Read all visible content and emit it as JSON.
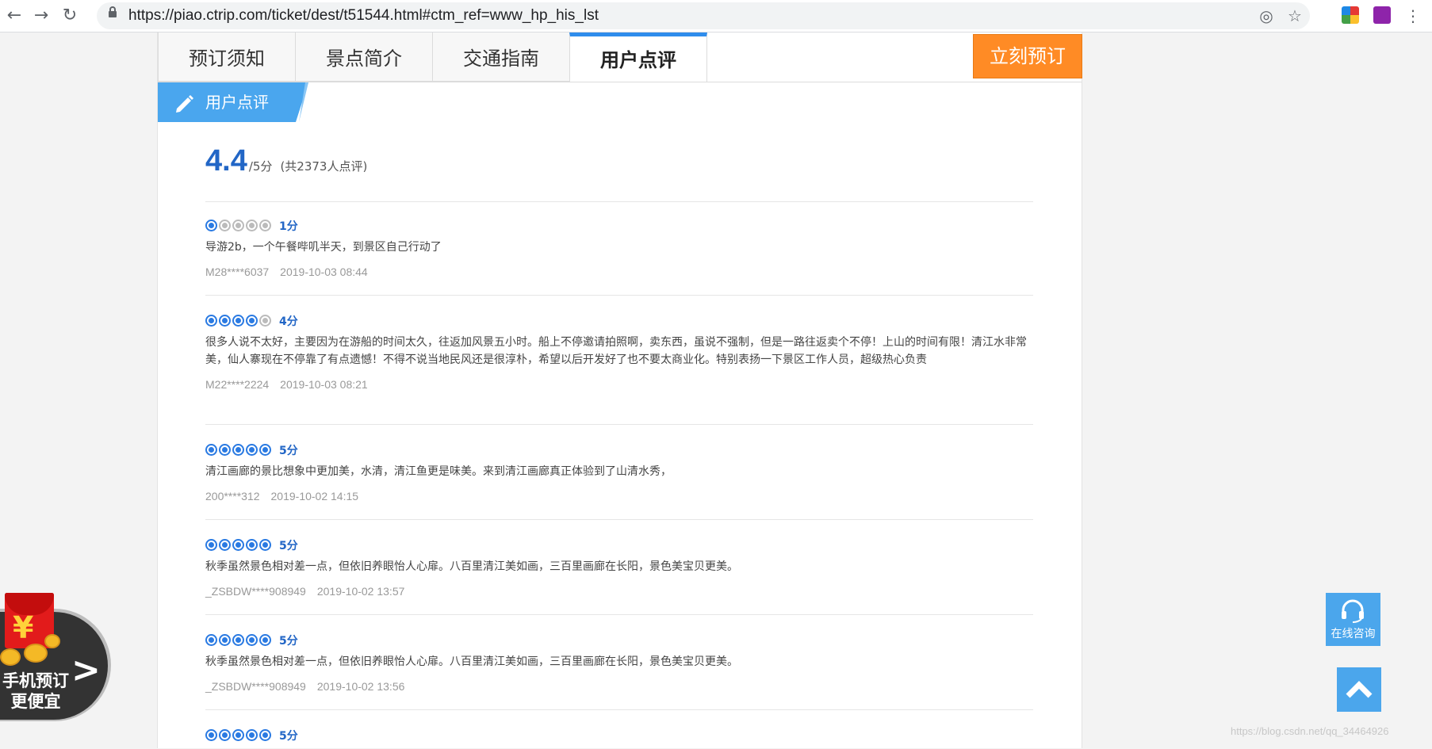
{
  "browser": {
    "url": "https://piao.ctrip.com/ticket/dest/t51544.html#ctm_ref=www_hp_his_lst",
    "icons": [
      "back-icon",
      "forward-icon",
      "reload-icon",
      "lock-icon",
      "location-icon",
      "star-icon",
      "extension-icon",
      "kebab-menu-icon"
    ]
  },
  "tabs": [
    {
      "label": "预订须知"
    },
    {
      "label": "景点简介"
    },
    {
      "label": "交通指南"
    },
    {
      "label": "用户点评",
      "active": true
    }
  ],
  "book_button": "立刻预订",
  "section_title": "用户点评",
  "summary": {
    "score": "4.4",
    "max": "/5分",
    "count": "(共2373人点评)"
  },
  "reviews": [
    {
      "rating": 1,
      "score_label": "1分",
      "text": "导游2b，一个午餐哔叽半天，到景区自己行动了",
      "user": "M28****6037",
      "time": "2019-10-03 08:44"
    },
    {
      "rating": 4,
      "score_label": "4分",
      "text": "很多人说不太好，主要因为在游船的时间太久，往返加风景五小时。船上不停邀请拍照啊，卖东西，虽说不强制，但是一路往返卖个不停！上山的时间有限！清江水非常美，仙人寨现在不停靠了有点遗憾！不得不说当地民风还是很淳朴，希望以后开发好了也不要太商业化。特别表扬一下景区工作人员，超级热心负责",
      "user": "M22****2224",
      "time": "2019-10-03 08:21"
    },
    {
      "rating": 5,
      "score_label": "5分",
      "text": "清江画廊的景比想象中更加美，水清，清江鱼更是味美。来到清江画廊真正体验到了山清水秀，",
      "user": "200****312",
      "time": "2019-10-02 14:15"
    },
    {
      "rating": 5,
      "score_label": "5分",
      "text": "秋季虽然景色相对差一点，但依旧养眼怡人心扉。八百里清江美如画，三百里画廊在长阳，景色美宝贝更美。",
      "user": "_ZSBDW****908949",
      "time": "2019-10-02 13:57"
    },
    {
      "rating": 5,
      "score_label": "5分",
      "text": "秋季虽然景色相对差一点，但依旧养眼怡人心扉。八百里清江美如画，三百里画廊在长阳，景色美宝贝更美。",
      "user": "_ZSBDW****908949",
      "time": "2019-10-02 13:56"
    },
    {
      "rating": 5,
      "score_label": "5分",
      "text": "",
      "user": "",
      "time": ""
    }
  ],
  "promo": {
    "line1": "手机预订",
    "line2": "更便宜",
    "symbol": "¥"
  },
  "consult_label": "在线咨询",
  "watermark": "https://blog.csdn.net/qq_34464926",
  "colors": {
    "accent": "#2f8dec",
    "score_blue": "#2266c6",
    "book_orange": "#ff8b25",
    "float_blue": "#4ba6ec"
  }
}
